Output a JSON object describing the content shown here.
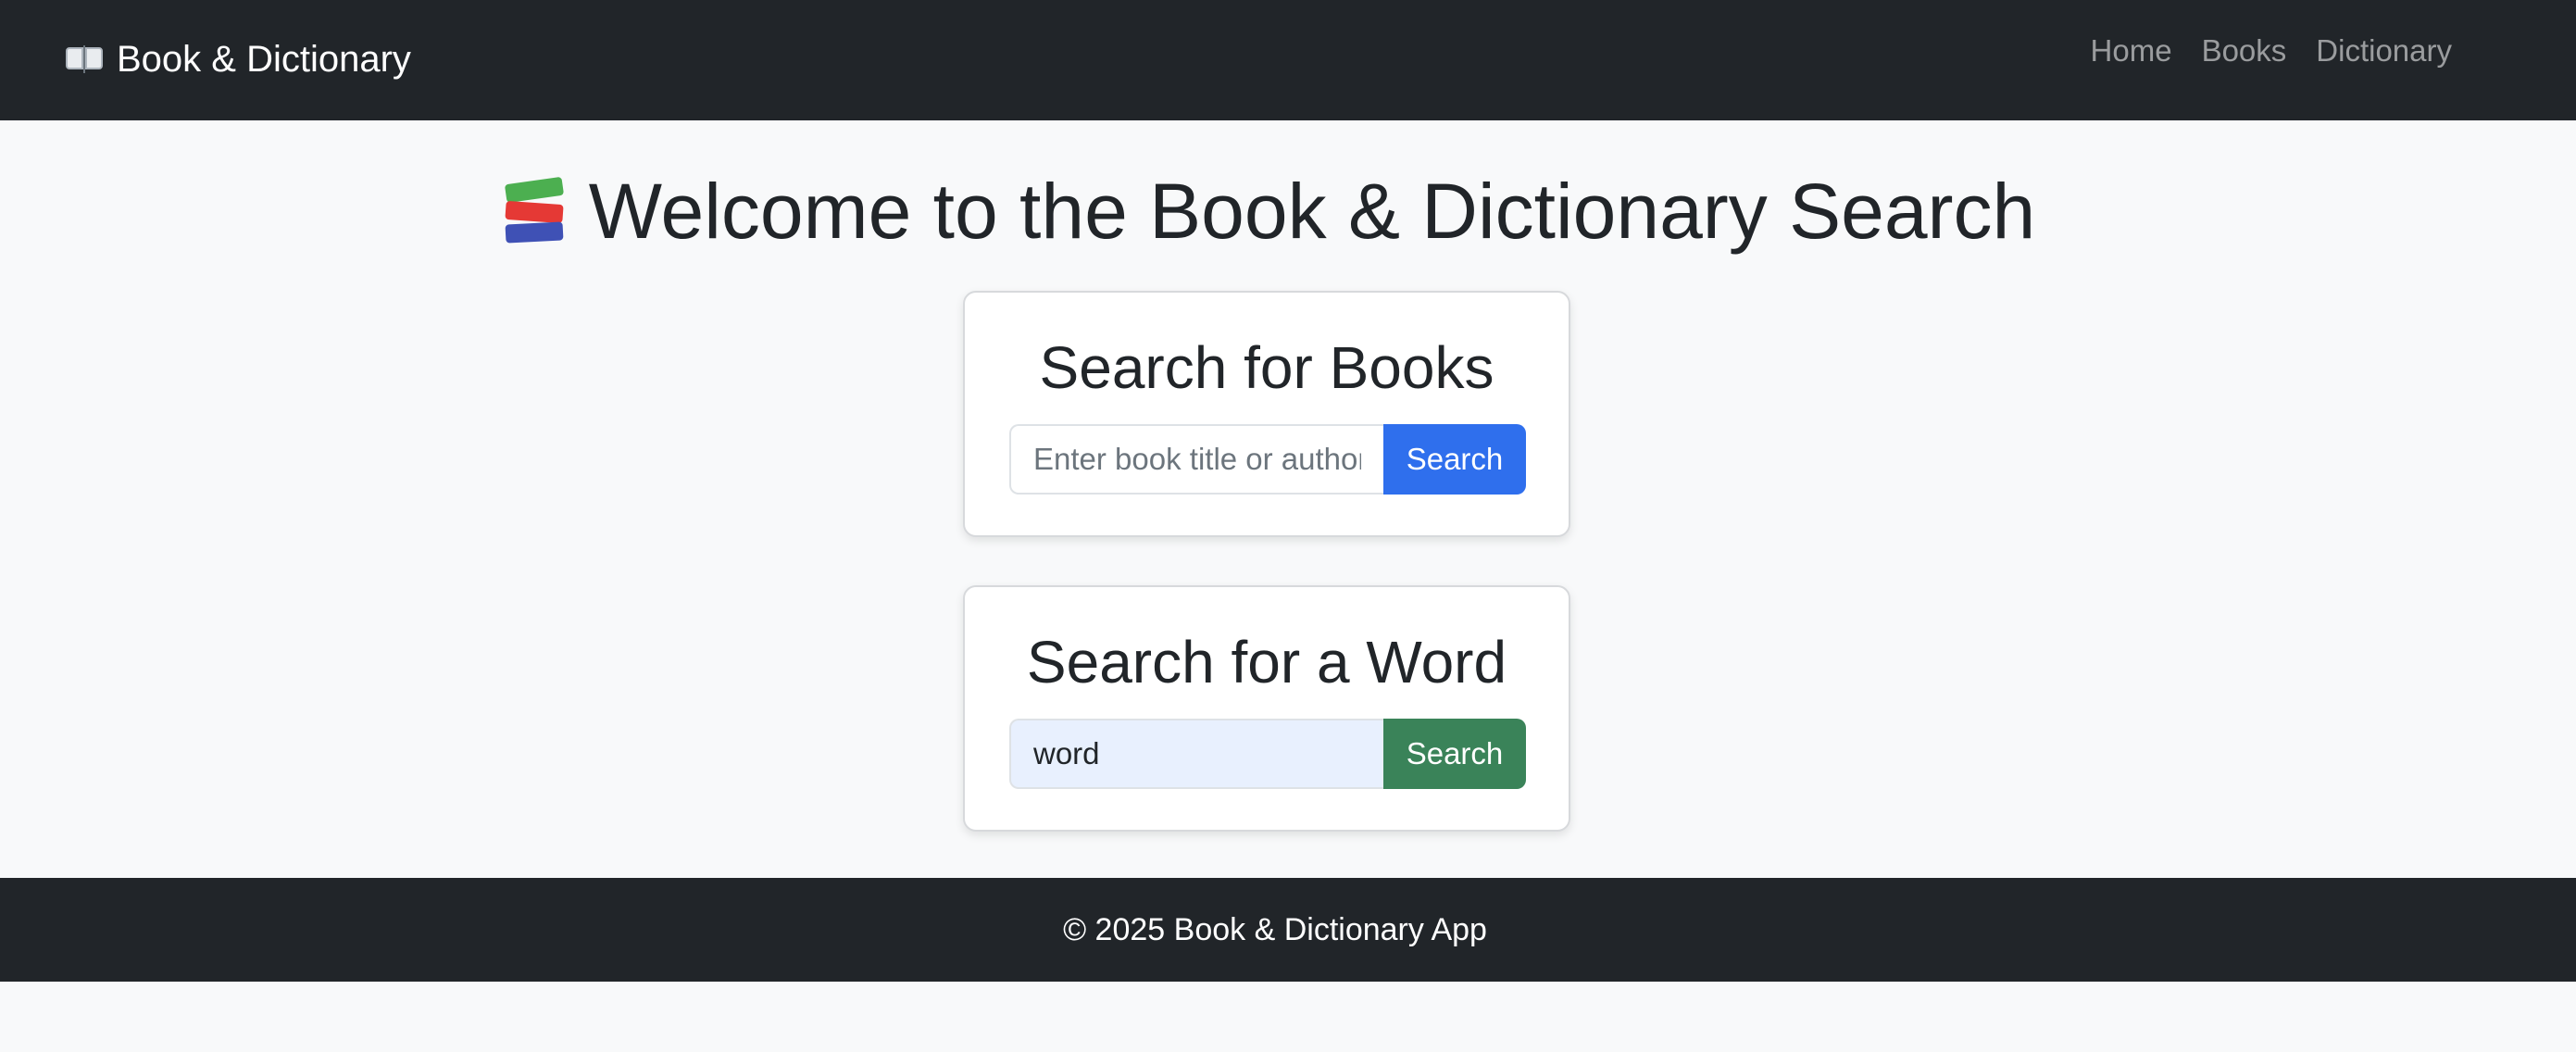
{
  "navbar": {
    "brand_icon": "open-book-icon",
    "brand_label": "Book & Dictionary",
    "links": [
      {
        "label": "Home"
      },
      {
        "label": "Books"
      },
      {
        "label": "Dictionary"
      }
    ],
    "background": "#212529"
  },
  "main": {
    "heading_icon": "books-stack-icon",
    "heading": "Welcome to the Book & Dictionary Search",
    "book_search": {
      "title": "Search for Books",
      "placeholder": "Enter book title or author",
      "value": "",
      "button_label": "Search",
      "button_color": "#2f6fed"
    },
    "word_search": {
      "title": "Search for a Word",
      "placeholder": "",
      "value": "word",
      "button_label": "Search",
      "button_color": "#3a8359"
    }
  },
  "footer": {
    "text": "© 2025 Book & Dictionary App"
  }
}
